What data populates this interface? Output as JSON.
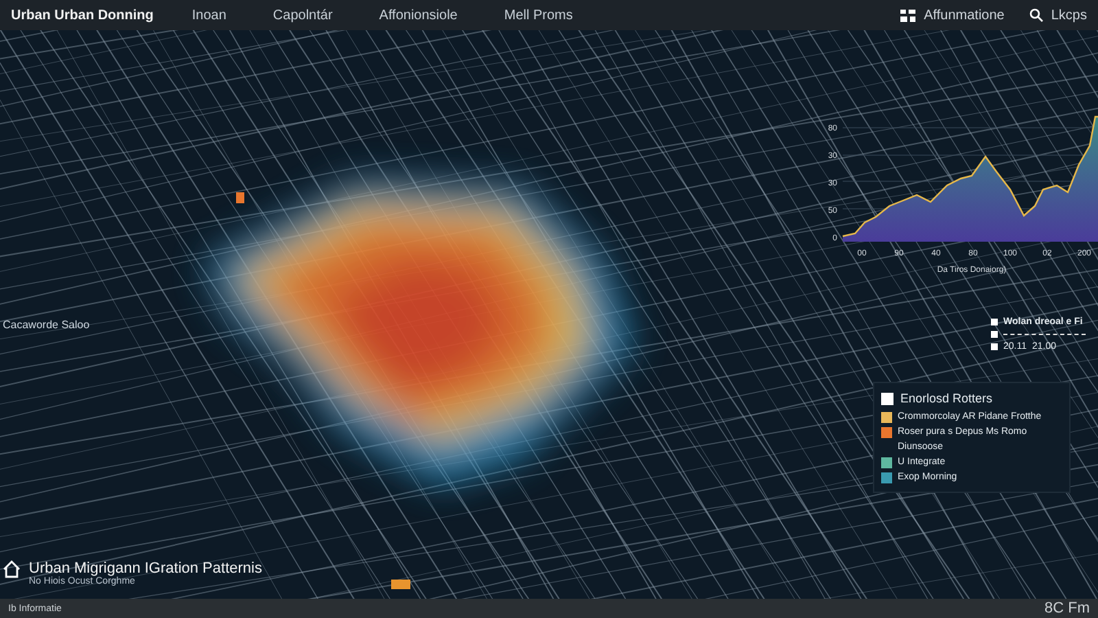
{
  "top_bar": {
    "brand": "Urban Urban Donning",
    "nav": [
      {
        "label": "Inoan",
        "selected": false
      },
      {
        "label": "Capolntár",
        "selected": false
      },
      {
        "label": "Affonionsiole",
        "selected": false
      },
      {
        "label": "Mell Proms",
        "selected": false
      }
    ],
    "actions": [
      {
        "kind": "grid",
        "label": "Affunmatione"
      },
      {
        "kind": "search",
        "label": "Lkcps"
      }
    ]
  },
  "map": {
    "side_label": "Cacaworde Saloo"
  },
  "chart": {
    "yticks": [
      "80",
      "30",
      "30",
      "50",
      "0"
    ],
    "xticks": [
      "00",
      "90",
      "40",
      "80",
      "100",
      "02",
      "200"
    ],
    "xlabel": "Da Tiros Donaiorg)"
  },
  "mini_legend": {
    "title": "Wolan dreoal e Fi",
    "values": [
      "20.11",
      "21.00"
    ]
  },
  "legend": {
    "title": "Enorlosd Rotters",
    "items": [
      {
        "label": "Crommorcolay AR Pidane Frotthe",
        "color": "#e8b85a"
      },
      {
        "label": "Roser pura s Depus Ms Romo",
        "color": "#e8762e"
      },
      {
        "label": "Diunsoose"
      },
      {
        "label": "U Integrate",
        "color": "#5fb8a0"
      },
      {
        "label": "Exop Morning",
        "color": "#3a9bb0"
      }
    ]
  },
  "title_block": {
    "title": "Urban Migrigann IGration Patternis",
    "subtitle": "No Hiois Ocust Corghme"
  },
  "status_bar": {
    "left": "Ib Informatie",
    "right": "8C Fm"
  }
}
